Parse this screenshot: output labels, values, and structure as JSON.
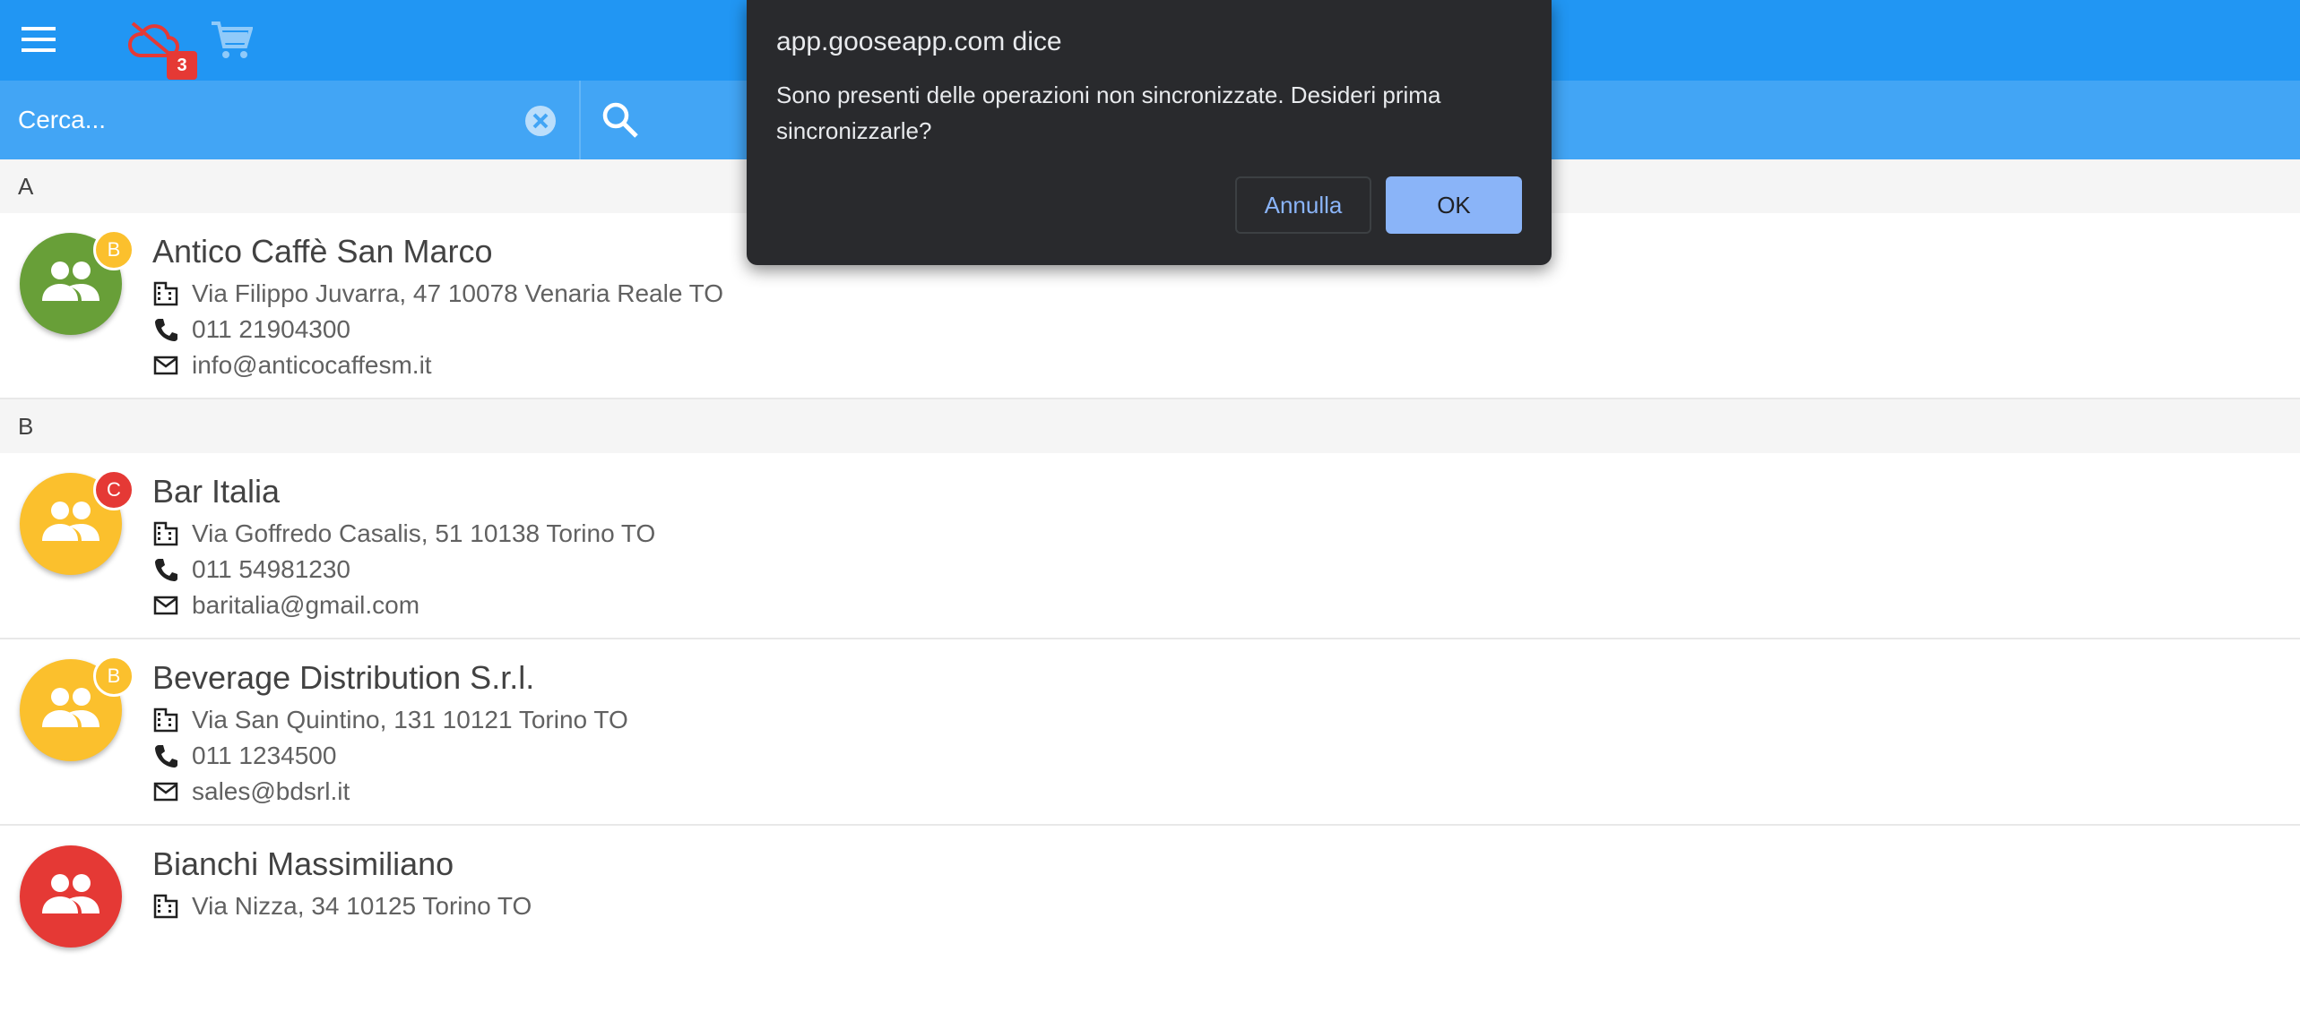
{
  "header": {
    "sync_pending_count": "3"
  },
  "search": {
    "placeholder": "Cerca..."
  },
  "colors": {
    "primary": "#2196f3",
    "search_bar": "#42a5f5",
    "avatar_green": "#689f38",
    "avatar_yellow": "#fbc02d",
    "avatar_red": "#e53935",
    "badge_b": "#fbc02d",
    "badge_c": "#e53935"
  },
  "sections": [
    {
      "letter": "A",
      "items": [
        {
          "name": "Antico Caffè San Marco",
          "badge": "B",
          "address": "Via Filippo Juvarra, 47 10078 Venaria Reale TO",
          "phone": "011 21904300",
          "email": "info@anticocaffesm.it",
          "avatar_color": "green"
        }
      ]
    },
    {
      "letter": "B",
      "items": [
        {
          "name": "Bar Italia",
          "badge": "C",
          "address": "Via Goffredo Casalis, 51 10138 Torino TO",
          "phone": "011 54981230",
          "email": "baritalia@gmail.com",
          "avatar_color": "yellow"
        },
        {
          "name": "Beverage Distribution S.r.l.",
          "badge": "B",
          "address": "Via San Quintino, 131 10121 Torino TO",
          "phone": "011 1234500",
          "email": "sales@bdsrl.it",
          "avatar_color": "yellow"
        },
        {
          "name": "Bianchi Massimiliano",
          "address": "Via Nizza, 34 10125 Torino TO",
          "avatar_color": "red"
        }
      ]
    }
  ],
  "dialog": {
    "title": "app.gooseapp.com dice",
    "message": "Sono presenti delle operazioni non sincronizzate. Desideri prima sincronizzarle?",
    "cancel_label": "Annulla",
    "ok_label": "OK"
  }
}
